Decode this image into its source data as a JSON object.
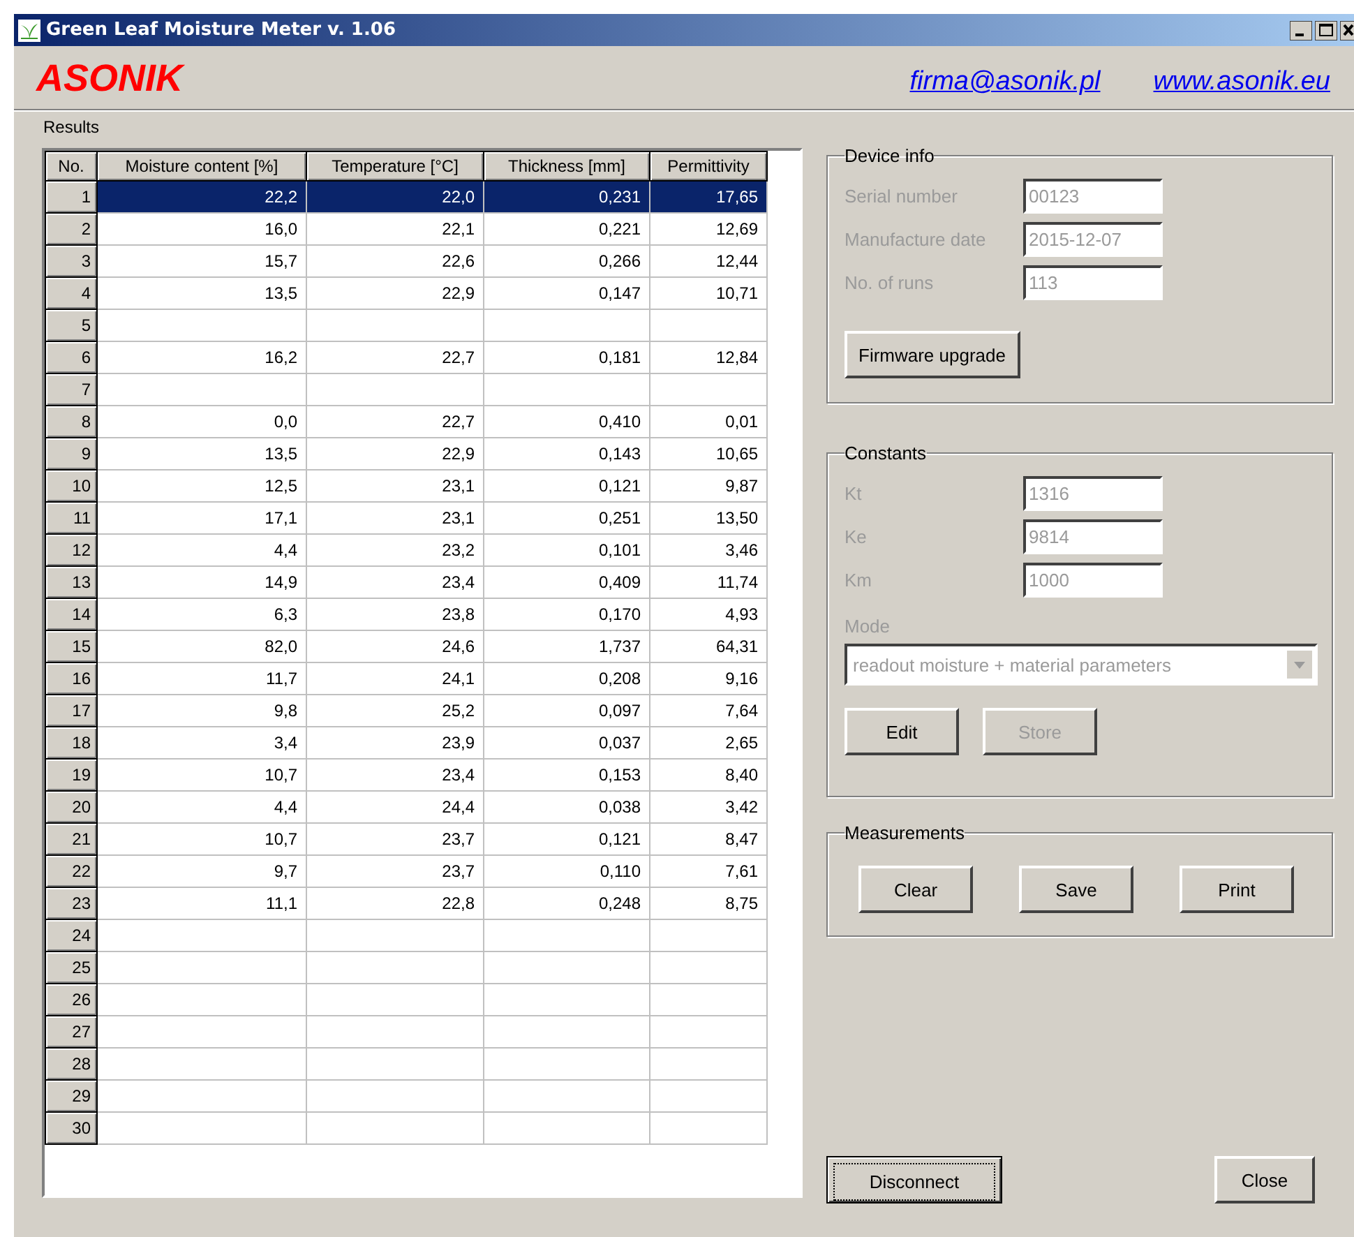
{
  "window": {
    "title": "Green Leaf Moisture Meter v. 1.06"
  },
  "header": {
    "brand": "ASONIK",
    "links": [
      "firma@asonik.pl",
      "www.asonik.eu"
    ]
  },
  "results": {
    "label": "Results",
    "columns": [
      "No.",
      "Moisture content [%]",
      "Temperature [°C]",
      "Thickness [mm]",
      "Permittivity"
    ],
    "rows": [
      {
        "no": "1",
        "cells": [
          "22,2",
          "22,0",
          "0,231",
          "17,65"
        ],
        "selected": true
      },
      {
        "no": "2",
        "cells": [
          "16,0",
          "22,1",
          "0,221",
          "12,69"
        ],
        "selected": false
      },
      {
        "no": "3",
        "cells": [
          "15,7",
          "22,6",
          "0,266",
          "12,44"
        ],
        "selected": false
      },
      {
        "no": "4",
        "cells": [
          "13,5",
          "22,9",
          "0,147",
          "10,71"
        ],
        "selected": false
      },
      {
        "no": "5",
        "selected": false
      },
      {
        "no": "6",
        "cells": [
          "16,2",
          "22,7",
          "0,181",
          "12,84"
        ],
        "selected": false
      },
      {
        "no": "7",
        "selected": false
      },
      {
        "no": "8",
        "cells": [
          "0,0",
          "22,7",
          "0,410",
          "0,01"
        ],
        "selected": false
      },
      {
        "no": "9",
        "cells": [
          "13,5",
          "22,9",
          "0,143",
          "10,65"
        ],
        "selected": false
      },
      {
        "no": "10",
        "cells": [
          "12,5",
          "23,1",
          "0,121",
          "9,87"
        ],
        "selected": false
      },
      {
        "no": "11",
        "cells": [
          "17,1",
          "23,1",
          "0,251",
          "13,50"
        ],
        "selected": false
      },
      {
        "no": "12",
        "cells": [
          "4,4",
          "23,2",
          "0,101",
          "3,46"
        ],
        "selected": false
      },
      {
        "no": "13",
        "cells": [
          "14,9",
          "23,4",
          "0,409",
          "11,74"
        ],
        "selected": false
      },
      {
        "no": "14",
        "cells": [
          "6,3",
          "23,8",
          "0,170",
          "4,93"
        ],
        "selected": false
      },
      {
        "no": "15",
        "cells": [
          "82,0",
          "24,6",
          "1,737",
          "64,31"
        ],
        "selected": false
      },
      {
        "no": "16",
        "cells": [
          "11,7",
          "24,1",
          "0,208",
          "9,16"
        ],
        "selected": false
      },
      {
        "no": "17",
        "cells": [
          "9,8",
          "25,2",
          "0,097",
          "7,64"
        ],
        "selected": false
      },
      {
        "no": "18",
        "cells": [
          "3,4",
          "23,9",
          "0,037",
          "2,65"
        ],
        "selected": false
      },
      {
        "no": "19",
        "cells": [
          "10,7",
          "23,4",
          "0,153",
          "8,40"
        ],
        "selected": false
      },
      {
        "no": "20",
        "cells": [
          "4,4",
          "24,4",
          "0,038",
          "3,42"
        ],
        "selected": false
      },
      {
        "no": "21",
        "cells": [
          "10,7",
          "23,7",
          "0,121",
          "8,47"
        ],
        "selected": false
      },
      {
        "no": "22",
        "cells": [
          "9,7",
          "23,7",
          "0,110",
          "7,61"
        ],
        "selected": false
      },
      {
        "no": "23",
        "cells": [
          "11,1",
          "22,8",
          "0,248",
          "8,75"
        ],
        "selected": false
      },
      {
        "no": "24",
        "selected": false
      },
      {
        "no": "25",
        "selected": false
      },
      {
        "no": "26",
        "selected": false
      },
      {
        "no": "27",
        "selected": false
      },
      {
        "no": "28",
        "selected": false
      },
      {
        "no": "29",
        "selected": false
      },
      {
        "no": "30",
        "selected": false
      }
    ]
  },
  "device_info": {
    "title": "Device info",
    "fields": [
      {
        "label": "Serial number",
        "value": "00123",
        "disabled": true
      },
      {
        "label": "Manufacture date",
        "value": "2015-12-07",
        "disabled": true
      },
      {
        "label": "No. of runs",
        "value": "113",
        "disabled": true
      }
    ],
    "button": {
      "label": "Firmware upgrade",
      "disabled": false
    }
  },
  "constants": {
    "title": "Constants",
    "fields": [
      {
        "label": "Kt",
        "value": "1316",
        "disabled": true
      },
      {
        "label": "Ke",
        "value": "9814",
        "disabled": true
      },
      {
        "label": "Km",
        "value": "1000",
        "disabled": true
      }
    ],
    "mode": {
      "label": "Mode",
      "value": "readout moisture + material parameters",
      "disabled": true
    },
    "buttons": [
      {
        "label": "Edit",
        "disabled": false
      },
      {
        "label": "Store",
        "disabled": true
      }
    ]
  },
  "measurements": {
    "title": "Measurements",
    "buttons": [
      {
        "label": "Clear",
        "disabled": false
      },
      {
        "label": "Save",
        "disabled": false
      },
      {
        "label": "Print",
        "disabled": false
      }
    ]
  },
  "footer_buttons": [
    {
      "label": "Disconnect",
      "focused": true
    },
    {
      "label": "Close",
      "focused": false
    }
  ]
}
